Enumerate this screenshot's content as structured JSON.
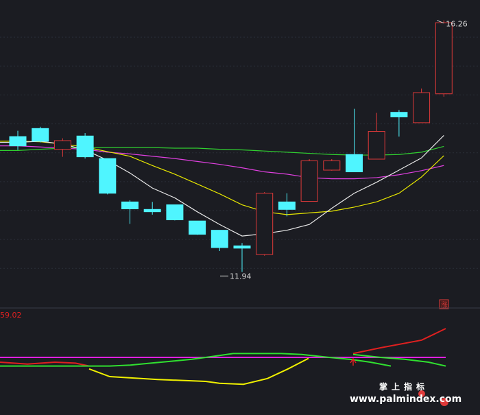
{
  "chart_data": [
    {
      "type": "candlestick",
      "ylim": [
        11.6,
        16.5
      ],
      "grid": true,
      "colors": {
        "up": "#e03a3a",
        "down": "#4ff5ff",
        "ma5": "#e8e8e8",
        "ma10": "#e6e600",
        "ma20": "#e040e0",
        "ma60": "#30d030"
      },
      "candles": [
        {
          "o": 14.28,
          "h": 14.38,
          "l": 14.05,
          "c": 14.12
        },
        {
          "o": 14.42,
          "h": 14.45,
          "l": 14.18,
          "c": 14.2
        },
        {
          "o": 14.06,
          "h": 14.25,
          "l": 13.93,
          "c": 14.21
        },
        {
          "o": 14.29,
          "h": 14.34,
          "l": 13.9,
          "c": 13.93
        },
        {
          "o": 13.9,
          "h": 13.9,
          "l": 13.28,
          "c": 13.3
        },
        {
          "o": 13.15,
          "h": 13.18,
          "l": 12.77,
          "c": 13.03
        },
        {
          "o": 13.02,
          "h": 13.15,
          "l": 12.93,
          "c": 12.98
        },
        {
          "o": 13.1,
          "h": 13.1,
          "l": 12.83,
          "c": 12.84
        },
        {
          "o": 12.82,
          "h": 12.82,
          "l": 12.58,
          "c": 12.59
        },
        {
          "o": 12.66,
          "h": 12.66,
          "l": 12.3,
          "c": 12.36
        },
        {
          "o": 12.39,
          "h": 12.44,
          "l": 11.94,
          "c": 12.35
        },
        {
          "o": 12.24,
          "h": 13.32,
          "l": 12.22,
          "c": 13.3
        },
        {
          "o": 13.15,
          "h": 13.3,
          "l": 12.9,
          "c": 13.02
        },
        {
          "o": 13.16,
          "h": 13.89,
          "l": 13.16,
          "c": 13.86
        },
        {
          "o": 13.7,
          "h": 13.89,
          "l": 13.69,
          "c": 13.86
        },
        {
          "o": 13.97,
          "h": 14.76,
          "l": 13.87,
          "c": 13.67
        },
        {
          "o": 13.89,
          "h": 14.69,
          "l": 13.89,
          "c": 14.37
        },
        {
          "o": 14.7,
          "h": 14.74,
          "l": 14.28,
          "c": 14.62
        },
        {
          "o": 14.52,
          "h": 15.11,
          "l": 14.52,
          "c": 15.04
        },
        {
          "o": 15.02,
          "h": 16.29,
          "l": 14.97,
          "c": 16.25
        }
      ],
      "ma5": [
        14.18,
        14.2,
        14.15,
        14.05,
        13.87,
        13.65,
        13.39,
        13.22,
        12.98,
        12.76,
        12.56,
        12.6,
        12.66,
        12.76,
        13.04,
        13.3,
        13.49,
        13.7,
        13.91,
        14.3
      ],
      "ma10": [
        14.2,
        14.19,
        14.15,
        14.1,
        14.02,
        13.94,
        13.78,
        13.63,
        13.46,
        13.29,
        13.1,
        12.98,
        12.93,
        12.96,
        12.99,
        13.06,
        13.15,
        13.3,
        13.58,
        13.95
      ],
      "ma20": [
        14.12,
        14.1,
        14.08,
        14.06,
        14.01,
        13.98,
        13.94,
        13.9,
        13.85,
        13.8,
        13.74,
        13.67,
        13.63,
        13.57,
        13.55,
        13.55,
        13.57,
        13.62,
        13.69,
        13.78
      ],
      "ma60": [
        14.04,
        14.06,
        14.08,
        14.09,
        14.09,
        14.09,
        14.09,
        14.08,
        14.08,
        14.06,
        14.05,
        14.03,
        14.01,
        13.99,
        13.97,
        13.96,
        13.96,
        13.97,
        14.01,
        14.11
      ],
      "annotations": {
        "high": "16.26",
        "low": "11.94",
        "badge": "涨"
      }
    },
    {
      "type": "line",
      "label": "59.02",
      "ylim": [
        -10,
        90
      ],
      "reference_line": 50,
      "series": [
        {
          "color": "#e02020",
          "values": [
            45,
            43,
            45,
            44,
            41
          ]
        },
        {
          "color": "#30e030",
          "values": [
            41,
            41,
            41,
            41,
            41,
            42,
            44,
            46,
            48,
            50,
            52,
            54,
            54,
            54,
            54,
            54,
            53,
            50,
            48,
            45,
            41
          ]
        },
        {
          "color": "#f0f000",
          "values": [
            38,
            30,
            27,
            25,
            23,
            22,
            28,
            38,
            49
          ]
        },
        {
          "color": "#e02020",
          "values": [
            54,
            60,
            68,
            80
          ]
        },
        {
          "color": "#30e030",
          "values": [
            53,
            50,
            48,
            45,
            41
          ]
        }
      ],
      "markers": [
        {
          "shape": "up-arrow",
          "color": "#e02020"
        },
        {
          "shape": "dot",
          "color": "#e03a3a"
        }
      ]
    }
  ],
  "watermark": {
    "text": "www.palmindex.com",
    "cn": "掌上指标"
  }
}
